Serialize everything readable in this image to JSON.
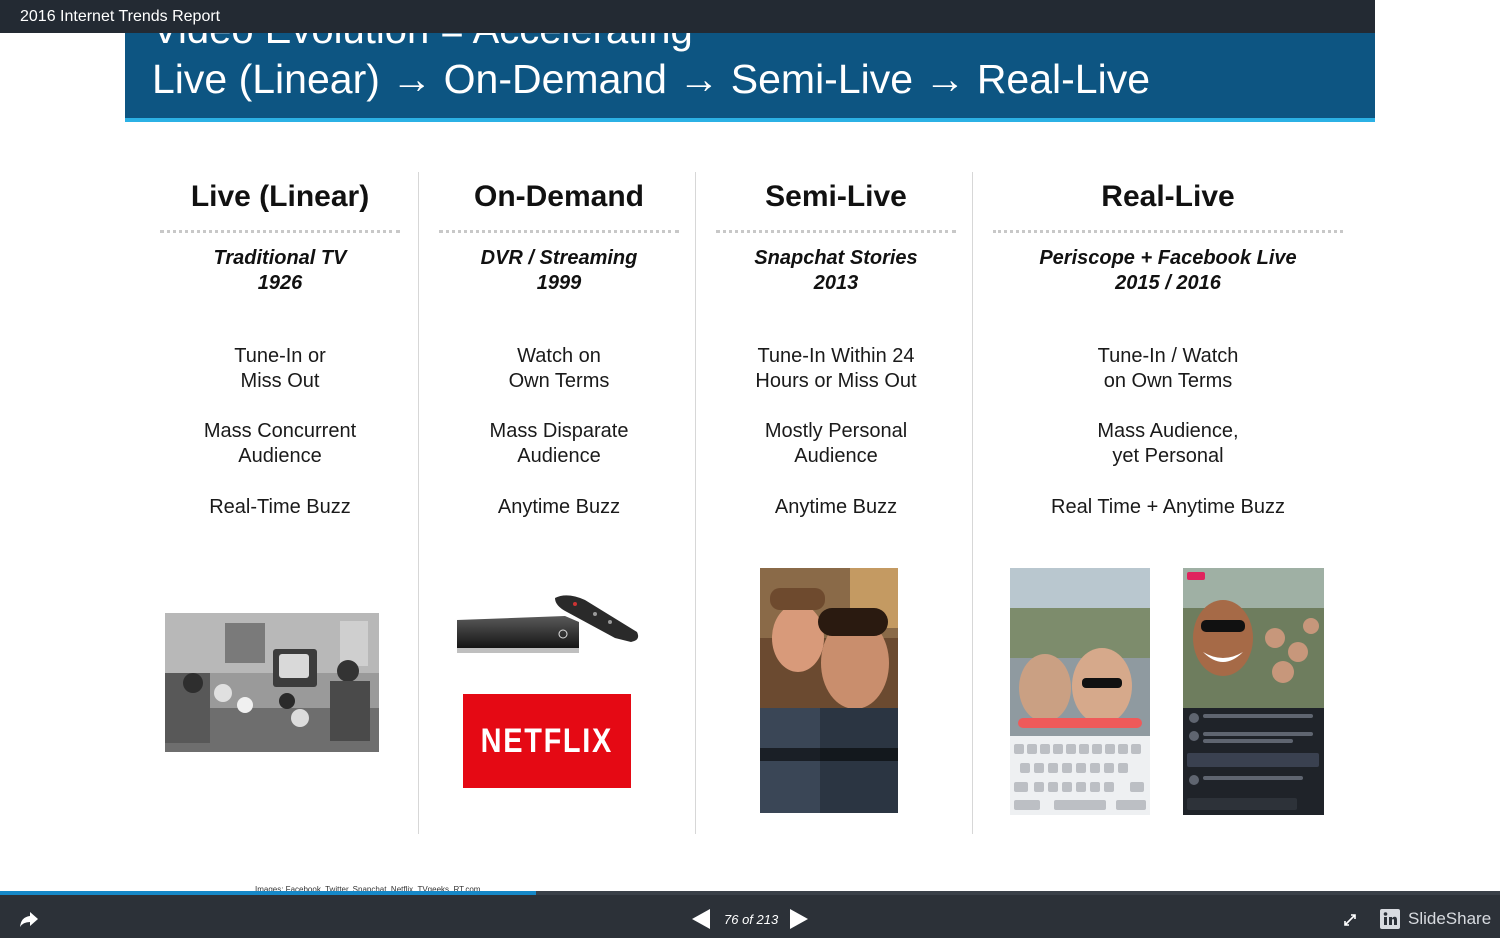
{
  "window": {
    "title": "2016 Internet Trends Report"
  },
  "slide": {
    "header_line1": "Video Evolution = Accelerating",
    "header_line2": "Live (Linear) → On-Demand → Semi-Live → Real-Live",
    "columns": [
      {
        "title": "Live (Linear)",
        "sub1": "Traditional TV",
        "sub2": "1926",
        "d1a": "Tune-In or",
        "d1b": "Miss Out",
        "d2a": "Mass Concurrent",
        "d2b": "Audience",
        "d3": "Real-Time Buzz"
      },
      {
        "title": "On-Demand",
        "sub1": "DVR / Streaming",
        "sub2": "1999",
        "d1a": "Watch on",
        "d1b": "Own Terms",
        "d2a": "Mass Disparate",
        "d2b": "Audience",
        "d3": "Anytime Buzz"
      },
      {
        "title": "Semi-Live",
        "sub1": "Snapchat Stories",
        "sub2": "2013",
        "d1a": "Tune-In Within 24",
        "d1b": "Hours or Miss Out",
        "d2a": "Mostly Personal",
        "d2b": "Audience",
        "d3": "Anytime Buzz"
      },
      {
        "title": "Real-Live",
        "sub1": "Periscope + Facebook Live",
        "sub2": "2015 / 2016",
        "d1a": "Tune-In / Watch",
        "d1b": "on Own Terms",
        "d2a": "Mass Audience,",
        "d2b": "yet Personal",
        "d3": "Real Time + Anytime Buzz"
      }
    ],
    "netflix_logo": "NETFLIX",
    "footer": "Images: Facebook, Twitter, Snapchat, Netflix, TVgeeks, RT.com"
  },
  "viewer": {
    "page_indicator": "76 of 213",
    "current_page": 76,
    "total_pages": 213,
    "progress": 0.357,
    "brand": "SlideShare",
    "icons": [
      "share-icon",
      "prev-slide-icon",
      "next-slide-icon",
      "fullscreen-icon",
      "linkedin-icon"
    ]
  },
  "colors": {
    "header": "#0d5582",
    "accent": "#2bb1e5",
    "netflix": "#e50914",
    "bar": "#2c3138"
  }
}
